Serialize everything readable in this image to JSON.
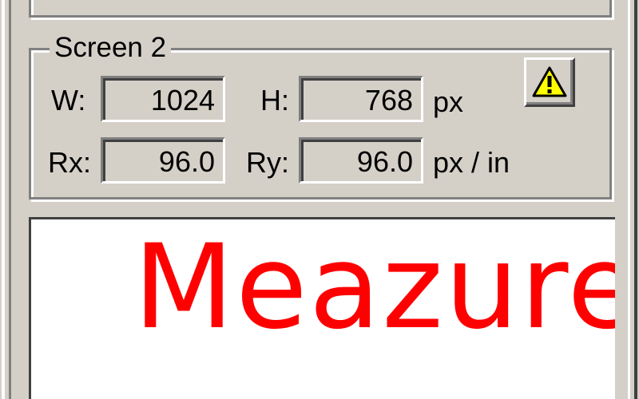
{
  "screen_group": {
    "title": "Screen 2",
    "width_label": "W:",
    "width_value": "1024",
    "height_label": "H:",
    "height_value": "768",
    "size_unit": "px",
    "res_x_label": "Rx:",
    "res_x_value": "96.0",
    "res_y_label": "Ry:",
    "res_y_value": "96.0",
    "res_unit": "px / in",
    "warning_icon": "warning-triangle-icon"
  },
  "canvas": {
    "text": "Meazure",
    "text_color": "#ff0000"
  },
  "colors": {
    "face": "#d4d0c8",
    "shadow": "#808080",
    "highlight": "#ffffff",
    "warning_yellow": "#ffff00"
  }
}
